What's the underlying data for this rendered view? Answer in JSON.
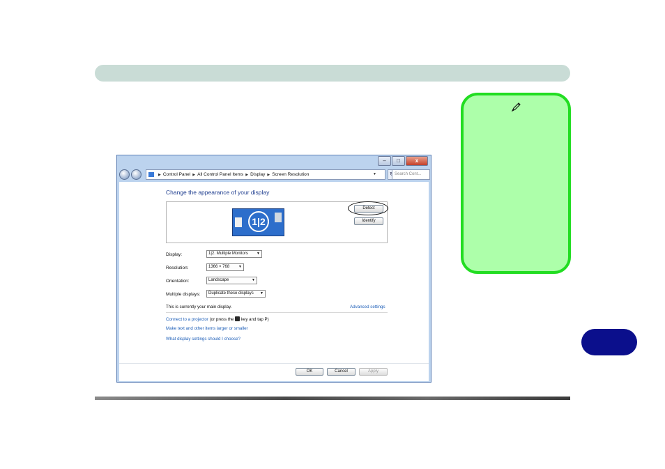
{
  "window": {
    "controls": {
      "minimize": "–",
      "maximize": "□",
      "close": "x"
    },
    "breadcrumbs": [
      "Control Panel",
      "All Control Panel Items",
      "Display",
      "Screen Resolution"
    ],
    "search_placeholder": "Search Cont...",
    "heading": "Change the appearance of your display",
    "monitor_label": "1|2",
    "buttons": {
      "detect": "Detect",
      "identify": "Identify",
      "ok": "OK",
      "cancel": "Cancel",
      "apply": "Apply"
    },
    "fields": {
      "display": {
        "label": "Display:",
        "value": "1|2. Multiple Monitors"
      },
      "resolution": {
        "label": "Resolution:",
        "value": "1366 × 768"
      },
      "orientation": {
        "label": "Orientation:",
        "value": "Landscape"
      },
      "multiple_displays": {
        "label": "Multiple displays:",
        "value": "Duplicate these displays"
      }
    },
    "main_display_text": "This is currently your main display.",
    "advanced_link": "Advanced settings",
    "projector_link": "Connect to a projector",
    "projector_suffix_a": "(or press the",
    "projector_suffix_b": "key and tap P)",
    "text_size_link": "Make text and other items larger or smaller",
    "help_link": "What display settings should I choose?"
  },
  "note": {
    "icon": "pencil-icon"
  },
  "colors": {
    "header_bar": "#c9dcd6",
    "note_fill": "#adffaa",
    "note_border": "#22dd22",
    "chapter_tab": "#0b0f8c",
    "link": "#1e5fb8"
  }
}
